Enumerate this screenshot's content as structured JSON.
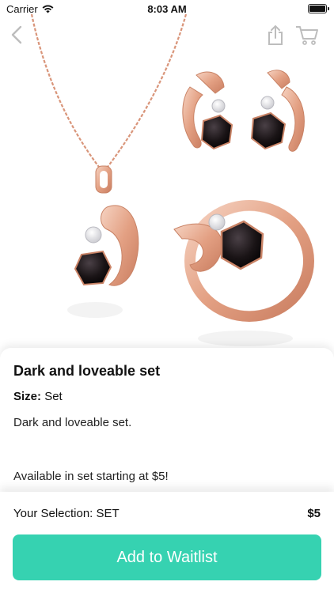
{
  "status_bar": {
    "carrier": "Carrier",
    "time": "8:03 AM",
    "wifi_icon": "wifi-icon",
    "battery_icon": "battery-icon"
  },
  "nav": {
    "back_icon": "chevron-left-icon",
    "share_icon": "share-icon",
    "cart_icon": "cart-icon"
  },
  "product": {
    "image": "jewelry-set-image",
    "title": "Dark and loveable set",
    "size_label": "Size:",
    "size_value": "Set",
    "description": "Dark and loveable set.",
    "availability": "Available in set starting at $5!"
  },
  "selection": {
    "label": "Your Selection: SET",
    "price": "$5"
  },
  "actions": {
    "waitlist_label": "Add to Waitlist"
  },
  "colors": {
    "accent": "#36d2b1",
    "rose_gold": "#e8a98c",
    "gem": "#1a1416"
  }
}
